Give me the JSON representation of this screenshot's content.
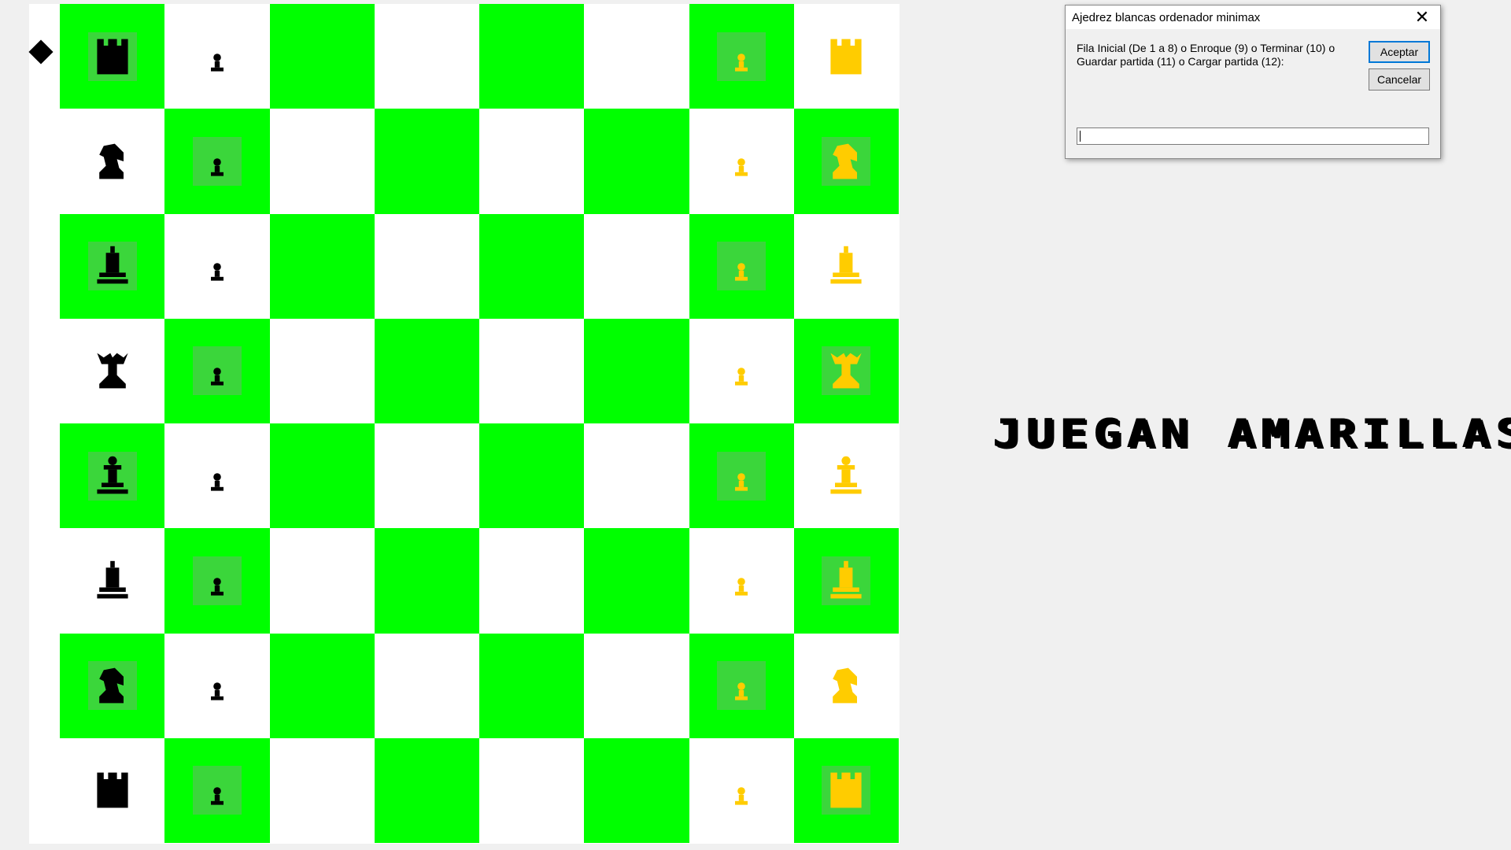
{
  "dialog": {
    "title": "Ajedrez blancas ordenador minimax",
    "prompt": "Fila Inicial (De 1 a 8) o Enroque (9) o Terminar (10) o Guardar partida (11) o Cargar partida (12):",
    "accept_label": "Aceptar",
    "cancel_label": "Cancelar",
    "input_value": ""
  },
  "status": {
    "text": "JUEGAN AMARILLAS"
  },
  "colors": {
    "dark_square": "#00ff00",
    "light_square": "#ffffff",
    "highlight": "#3bd63b",
    "black_piece": "#000000",
    "yellow_piece": "#ffcc00"
  },
  "board": {
    "rows": [
      [
        "black-rook",
        "black-pawn",
        "",
        "",
        "",
        "",
        "yellow-pawn",
        "yellow-rook"
      ],
      [
        "black-knight",
        "black-pawn",
        "",
        "",
        "",
        "",
        "yellow-pawn",
        "yellow-knight"
      ],
      [
        "black-bishop",
        "black-pawn",
        "",
        "",
        "",
        "",
        "yellow-pawn",
        "yellow-bishop"
      ],
      [
        "black-king",
        "black-pawn",
        "",
        "",
        "",
        "",
        "yellow-pawn",
        "yellow-king"
      ],
      [
        "black-queen",
        "black-pawn",
        "",
        "",
        "",
        "",
        "yellow-pawn",
        "yellow-queen"
      ],
      [
        "black-bishop",
        "black-pawn",
        "",
        "",
        "",
        "",
        "yellow-pawn",
        "yellow-bishop"
      ],
      [
        "black-knight",
        "black-pawn",
        "",
        "",
        "",
        "",
        "yellow-pawn",
        "yellow-knight"
      ],
      [
        "black-rook",
        "black-pawn",
        "",
        "",
        "",
        "",
        "yellow-pawn",
        "yellow-rook"
      ]
    ],
    "highlighted": [
      [
        true,
        false,
        false,
        false,
        false,
        false,
        true,
        false
      ],
      [
        false,
        true,
        false,
        false,
        false,
        false,
        false,
        true
      ],
      [
        true,
        false,
        false,
        false,
        false,
        false,
        true,
        false
      ],
      [
        false,
        true,
        false,
        false,
        false,
        false,
        false,
        true
      ],
      [
        true,
        false,
        false,
        false,
        false,
        false,
        true,
        false
      ],
      [
        false,
        true,
        false,
        false,
        false,
        false,
        false,
        true
      ],
      [
        true,
        false,
        false,
        false,
        false,
        false,
        true,
        false
      ],
      [
        false,
        true,
        false,
        false,
        false,
        false,
        false,
        true
      ]
    ]
  }
}
